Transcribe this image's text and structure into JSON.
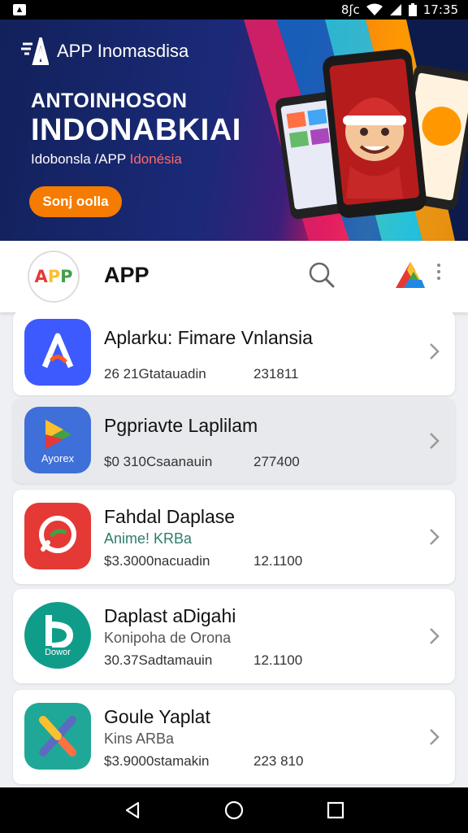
{
  "status_bar": {
    "time": "17:35",
    "left_indicator": "8ʃc",
    "notification_icon": "app-notification-icon"
  },
  "banner": {
    "brand": "APP Inomasdisa",
    "subtitle": "ANTOINHOSON",
    "title": "INDONABKIAI",
    "tagline_plain": "Idobonsla /APP ",
    "tagline_accent": "Idonésia",
    "cta_label": "Sonj oolla",
    "colors": {
      "bg": "#12215a",
      "cta": "#f57c00"
    }
  },
  "header": {
    "logo_text": "APP",
    "title": "APP",
    "search_icon": "search-icon",
    "brand_icon": "colorful-a-icon",
    "more_icon": "more-vert-icon"
  },
  "apps": [
    {
      "name": "Aplarku: Fimare Vnlansia",
      "subtitle": "",
      "meta_left": "26 21Gtatauadin",
      "meta_right": "231811",
      "icon": "a-logo-blue",
      "icon_label": ""
    },
    {
      "name": "Pgpriavte Laplilam",
      "subtitle": "",
      "meta_left": "$0 310Csaanauin",
      "meta_right": "277400",
      "icon": "play-triangle-blue",
      "icon_label": "Ayorex"
    },
    {
      "name": "Fahdal Daplase",
      "subtitle": "Anime! KRBa",
      "meta_left": "$3.3000nacuadin",
      "meta_right": "12.1100",
      "icon": "chat-red",
      "icon_label": ""
    },
    {
      "name": "Daplast aDigahi",
      "subtitle": "Konipoha de Orona",
      "meta_left": "30.37Sadtamauin",
      "meta_right": "12.1100",
      "icon": "b-teal",
      "icon_label": "Dowor"
    },
    {
      "name": "Goule Yaplat",
      "subtitle": "Kins ARBa",
      "meta_left": "$3.9000stamakin",
      "meta_right": "223 810",
      "icon": "x-teal",
      "icon_label": ""
    }
  ],
  "nav": {
    "back": "back-icon",
    "home": "home-icon",
    "recents": "recents-icon"
  }
}
